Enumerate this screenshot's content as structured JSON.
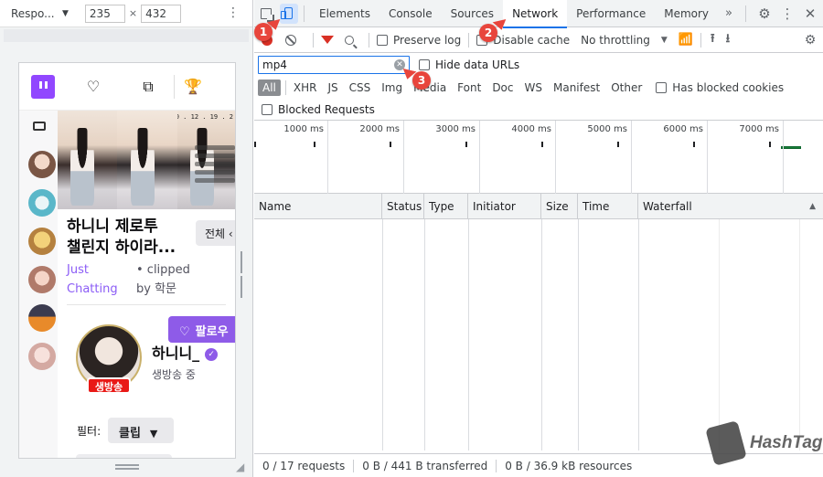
{
  "emulator": {
    "device": "Respo...",
    "width": "235",
    "height": "432",
    "times_sign": "×"
  },
  "twitch": {
    "title": "하니니 제로투\n챌린지 하이라...",
    "fullscreen_button": "전체 ‹",
    "category_line1": "Just",
    "category_line2": "Chatting",
    "meta_line1": "•  clipped",
    "meta_line2": "by 학문",
    "follow_button": "팔로우",
    "channel_name": "하니니_",
    "channel_status": "생방송 중",
    "live_badge": "생방송",
    "filter_label": "필터:",
    "filter_value": "클립",
    "thumb_clock": "0:0 . 12 . 19 . 2"
  },
  "devtools": {
    "tabs": [
      "Elements",
      "Console",
      "Sources",
      "Network",
      "Performance",
      "Memory"
    ],
    "active_tab": "Network",
    "more_tabs": "»",
    "toolbar": {
      "preserve_log": "Preserve log",
      "disable_cache": "Disable cache",
      "throttling": "No throttling"
    },
    "filter": {
      "value": "mp4",
      "hide_data_urls": "Hide data URLs"
    },
    "types": [
      "All",
      "XHR",
      "JS",
      "CSS",
      "Img",
      "Media",
      "Font",
      "Doc",
      "WS",
      "Manifest",
      "Other"
    ],
    "active_type": "All",
    "has_blocked_cookies": "Has blocked cookies",
    "blocked_requests": "Blocked Requests",
    "timeline_labels": [
      "1000 ms",
      "2000 ms",
      "3000 ms",
      "4000 ms",
      "5000 ms",
      "6000 ms",
      "7000 ms"
    ],
    "columns": [
      "Name",
      "Status",
      "Type",
      "Initiator",
      "Size",
      "Time",
      "Waterfall"
    ],
    "status_bar": {
      "requests": "0 / 17 requests",
      "transferred": "0 B / 441 B transferred",
      "resources": "0 B / 36.9 kB resources"
    }
  },
  "callouts": [
    "1",
    "2",
    "3"
  ],
  "watermark": "HashTag",
  "colors": {
    "accent_blue": "#1a73e8",
    "twitch_purple": "#8e5be8",
    "record_red": "#d93025",
    "callout_red": "#e8453c",
    "live_red": "#e91916"
  }
}
